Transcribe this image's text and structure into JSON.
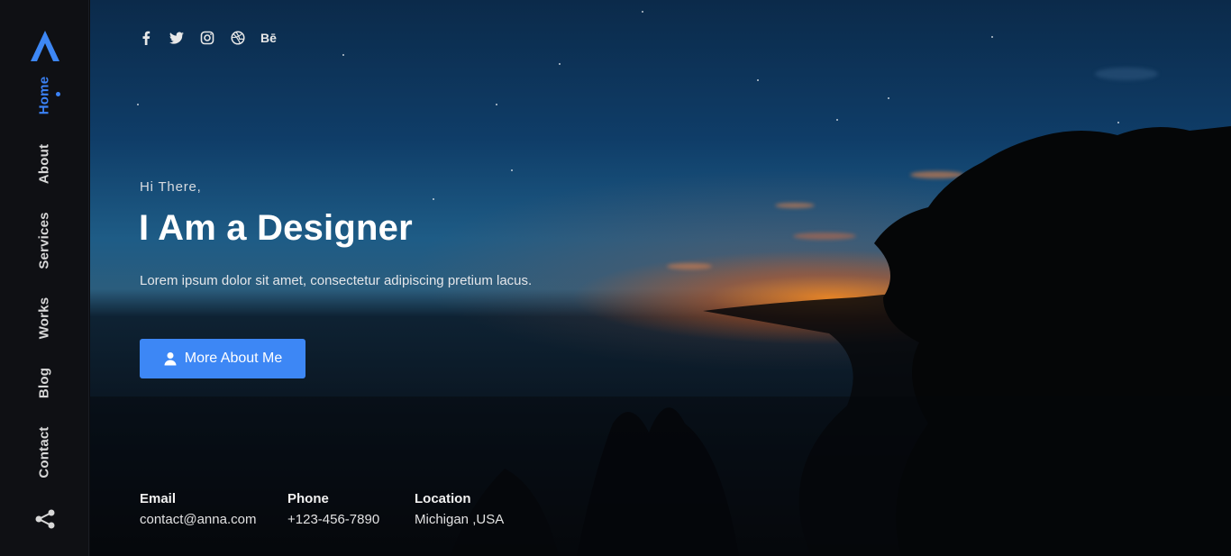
{
  "sidebar": {
    "logo_name": "logo-icon",
    "nav": [
      {
        "label": "Home",
        "active": true
      },
      {
        "label": "About",
        "active": false
      },
      {
        "label": "Services",
        "active": false
      },
      {
        "label": "Works",
        "active": false
      },
      {
        "label": "Blog",
        "active": false
      },
      {
        "label": "Contact",
        "active": false
      }
    ],
    "share_icon": "share-icon"
  },
  "socials": [
    "facebook-icon",
    "twitter-icon",
    "instagram-icon",
    "dribbble-icon",
    "behance-icon"
  ],
  "behance_label": "Bē",
  "hero": {
    "greeting": "Hi There,",
    "headline": "I Am a Designer",
    "description": "Lorem ipsum dolor sit amet, consectetur adipiscing pretium lacus.",
    "button_label": "More About Me"
  },
  "contact": {
    "email_label": "Email",
    "email_value": "contact@anna.com",
    "phone_label": "Phone",
    "phone_value": "+123-456-7890",
    "location_label": "Location",
    "location_value": "Michigan ,USA"
  },
  "colors": {
    "accent": "#3d87f5",
    "sidebar_bg": "#0f1014"
  }
}
